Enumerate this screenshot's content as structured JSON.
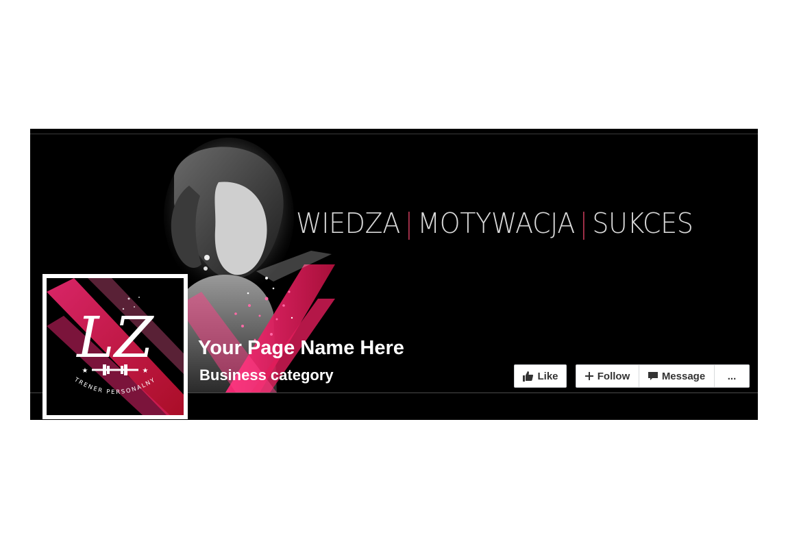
{
  "cover": {
    "tagline": {
      "words": [
        "WIEDZA",
        "MOTYWACJA",
        "SUKCES"
      ],
      "separator": "|"
    },
    "colors": {
      "background": "#000000",
      "accent_pink": "#e0256b",
      "accent_red": "#c8102e",
      "tagline": "#d8d8d8"
    }
  },
  "profile": {
    "monogram": "LZ",
    "subtitle": "TRENER PERSONALNY",
    "icon": "dumbbell-icon"
  },
  "page": {
    "name": "Your Page Name Here",
    "category": "Business category"
  },
  "actions": {
    "like_label": "Like",
    "follow_label": "Follow",
    "message_label": "Message",
    "more_label": "..."
  }
}
